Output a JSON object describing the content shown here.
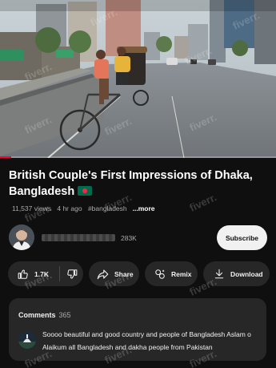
{
  "video": {
    "progress_fraction": 0.04
  },
  "title": {
    "text": "British Couple's First Impressions of Dhaka, Bangladesh",
    "flag_icon": "bangladesh-flag-icon"
  },
  "meta": {
    "views": "11,537 views",
    "age": "4 hr ago",
    "hashtag": "#bangladesh",
    "more": "...more"
  },
  "channel": {
    "subscribers": "283K",
    "subscribe_label": "Subscribe"
  },
  "actions": {
    "like_count": "1.7K",
    "share_label": "Share",
    "remix_label": "Remix",
    "download_label": "Download"
  },
  "comments": {
    "heading": "Comments",
    "count": "365",
    "top_comment": "Soooo beautiful and good country and people of Bangladesh Aslam o Alaikum all Bangladesh and dakha people from Pakistan"
  },
  "watermark": {
    "text": "fiverr."
  },
  "colors": {
    "background": "#0f0f0f",
    "pill": "#272727",
    "subscribe_bg": "#f1f1f1",
    "progress": "#ff0033",
    "flag_green": "#006a4e",
    "flag_red": "#f42a41"
  }
}
